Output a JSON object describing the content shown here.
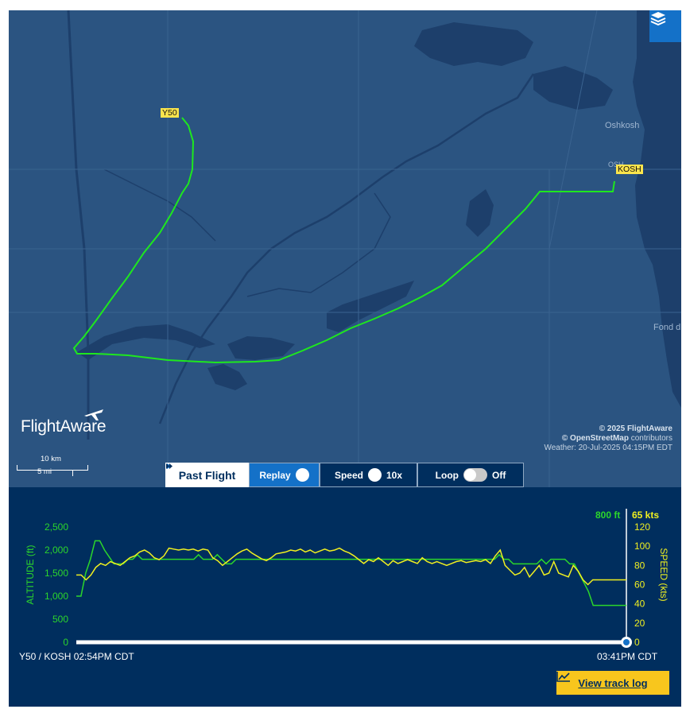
{
  "map": {
    "labels": {
      "oshkosh": "Oshkosh",
      "fond": "Fond d",
      "osh": "OSH"
    },
    "airports": {
      "origin": "Y50",
      "destination": "KOSH"
    },
    "logo": "FlightAware",
    "scale": {
      "km": "10 km",
      "mi": "5 mi"
    },
    "attribution": {
      "line1": "© 2025 FlightAware",
      "line2_brand": "© OpenStreetMap",
      "line2_rest": " contributors",
      "line3": "Weather: 20-Jul-2025 04:15PM EDT"
    },
    "layers_icon": "layers-icon",
    "colors": {
      "water": "#1d3f6b",
      "land": "#2b5481",
      "route": "#1ee81e"
    }
  },
  "controls": {
    "past_flight": "Past Flight",
    "replay": "Replay",
    "speed_label": "Speed",
    "speed_value": "10x",
    "loop_label": "Loop",
    "loop_value": "Off"
  },
  "chart_data": {
    "type": "line",
    "altitude_axis": {
      "label": "ALTITUDE (ft)",
      "ticks": [
        "2,500",
        "2,000",
        "1,500",
        "1,000",
        "500",
        "0"
      ],
      "range": [
        0,
        2500
      ]
    },
    "speed_axis": {
      "label": "SPEED (kts)",
      "ticks": [
        "120",
        "100",
        "80",
        "60",
        "40",
        "20",
        "0"
      ],
      "range": [
        0,
        120
      ]
    },
    "current_altitude": "800 ft",
    "current_speed": "65 kts",
    "start_label": "Y50 / KOSH 02:54PM CDT",
    "end_label": "03:41PM CDT",
    "series": [
      {
        "name": "ALTITUDE (ft)",
        "color": "#2bd62b",
        "values": [
          1000,
          1000,
          1500,
          1800,
          2200,
          2200,
          2000,
          1850,
          1700,
          1700,
          1700,
          1800,
          1800,
          1900,
          1800,
          1800,
          1800,
          1800,
          1800,
          1800,
          1800,
          1800,
          1800,
          1800,
          1800,
          1800,
          1900,
          1800,
          1800,
          1800,
          1900,
          1800,
          1700,
          1700,
          1800,
          1800,
          1800,
          1800,
          1800,
          1800,
          1800,
          1800,
          1800,
          1800,
          1800,
          1800,
          1800,
          1800,
          1800,
          1800,
          1800,
          1800,
          1800,
          1800,
          1800,
          1800,
          1800,
          1800,
          1800,
          1800,
          1800,
          1800,
          1800,
          1800,
          1800,
          1800,
          1800,
          1800,
          1800,
          1800,
          1800,
          1800,
          1800,
          1800,
          1800,
          1800,
          1800,
          1800,
          1800,
          1800,
          1800,
          1800,
          1800,
          1800,
          1800,
          1800,
          1800,
          1800,
          1800,
          1800,
          1900,
          1800,
          1800,
          1700,
          1700,
          1700,
          1700,
          1700,
          1700,
          1800,
          1700,
          1800,
          1800,
          1800,
          1800,
          1700,
          1700,
          1500,
          1300,
          1100,
          800,
          800,
          800
        ]
      },
      {
        "name": "SPEED (kts)",
        "color": "#f0f020",
        "values": [
          70,
          70,
          65,
          70,
          78,
          82,
          80,
          84,
          82,
          80,
          84,
          88,
          90,
          94,
          96,
          93,
          88,
          86,
          90,
          98,
          97,
          96,
          97,
          96,
          97,
          95,
          97,
          96,
          88,
          85,
          80,
          84,
          88,
          92,
          95,
          97,
          93,
          90,
          87,
          85,
          88,
          92,
          93,
          94,
          96,
          95,
          97,
          94,
          96,
          93,
          95,
          97,
          95,
          96,
          98,
          95,
          93,
          90,
          86,
          82,
          86,
          84,
          88,
          84,
          80,
          85,
          82,
          84,
          86,
          84,
          82,
          88,
          84,
          82,
          84,
          82,
          80,
          82,
          84,
          85,
          83,
          84,
          85,
          84,
          86,
          82,
          90,
          96,
          80,
          75,
          70,
          72,
          78,
          68,
          74,
          80,
          70,
          72,
          84,
          72,
          70,
          68,
          80,
          74,
          65,
          60,
          65,
          65,
          65
        ]
      }
    ]
  }
}
